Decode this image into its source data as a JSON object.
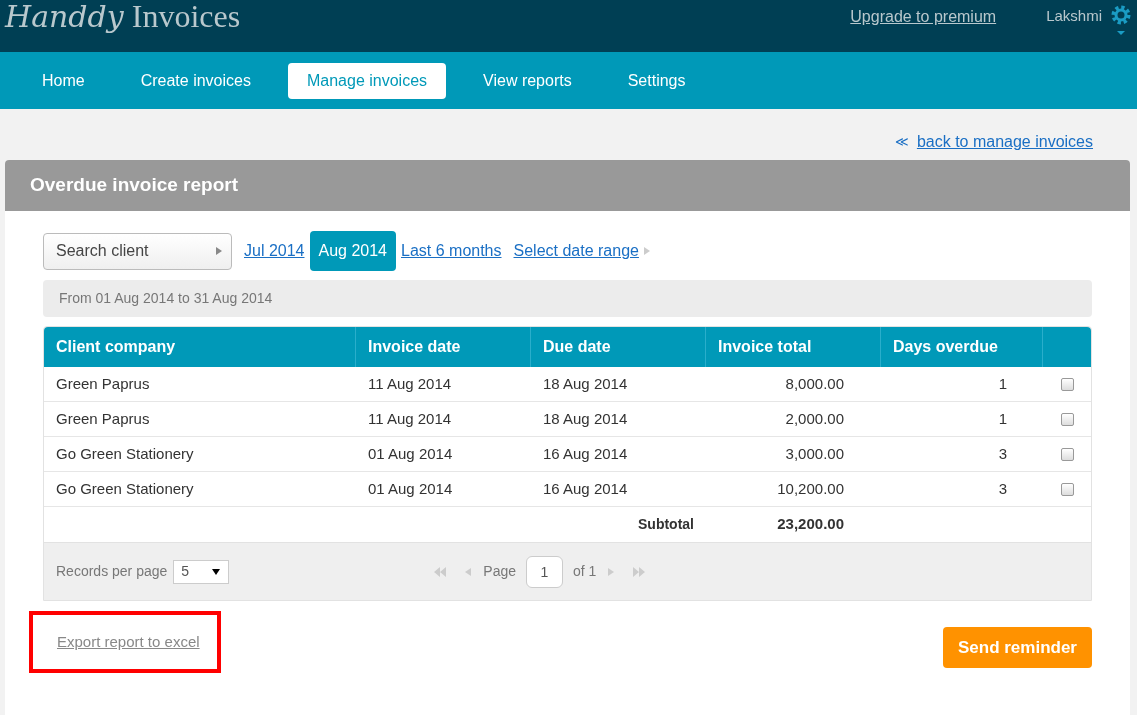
{
  "header": {
    "logo_script": "Handdy",
    "logo_text": "Invoices",
    "upgrade_link": "Upgrade to premium",
    "user_name": "Lakshmi"
  },
  "nav": [
    {
      "label": "Home",
      "selected": false
    },
    {
      "label": "Create invoices",
      "selected": false
    },
    {
      "label": "Manage invoices",
      "selected": true
    },
    {
      "label": "View reports",
      "selected": false
    },
    {
      "label": "Settings",
      "selected": false
    }
  ],
  "back_link": {
    "icon": "≪",
    "label": "back to manage invoices"
  },
  "report": {
    "title": "Overdue invoice report",
    "search": {
      "placeholder": "Search client"
    },
    "periods": [
      {
        "label": "Jul 2014",
        "selected": false
      },
      {
        "label": "Aug 2014",
        "selected": true
      },
      {
        "label": "Last 6 months",
        "selected": false
      },
      {
        "label": "Select date range",
        "selected": false
      }
    ],
    "range_text": "From 01 Aug 2014 to 31 Aug 2014",
    "table": {
      "columns": [
        "Client company",
        "Invoice date",
        "Due date",
        "Invoice total",
        "Days overdue"
      ],
      "rows": [
        {
          "client": "Green Paprus",
          "invoice_date": "11 Aug 2014",
          "due_date": "18 Aug 2014",
          "total": "8,000.00",
          "days": "1",
          "checked": false
        },
        {
          "client": "Green Paprus",
          "invoice_date": "11 Aug 2014",
          "due_date": "18 Aug 2014",
          "total": "2,000.00",
          "days": "1",
          "checked": false
        },
        {
          "client": "Go Green Stationery",
          "invoice_date": "01 Aug 2014",
          "due_date": "16 Aug 2014",
          "total": "3,000.00",
          "days": "3",
          "checked": false
        },
        {
          "client": "Go Green Stationery",
          "invoice_date": "01 Aug 2014",
          "due_date": "16 Aug 2014",
          "total": "10,200.00",
          "days": "3",
          "checked": false
        }
      ],
      "subtotal_label": "Subtotal",
      "subtotal_value": "23,200.00"
    },
    "pager": {
      "records_label": "Records per page",
      "records_value": "5",
      "page_label": "Page",
      "page_value": "1",
      "of_label": "of 1"
    },
    "export_link": {
      "label": "Export report to excel",
      "highlighted": true
    },
    "send_button": "Send reminder"
  }
}
